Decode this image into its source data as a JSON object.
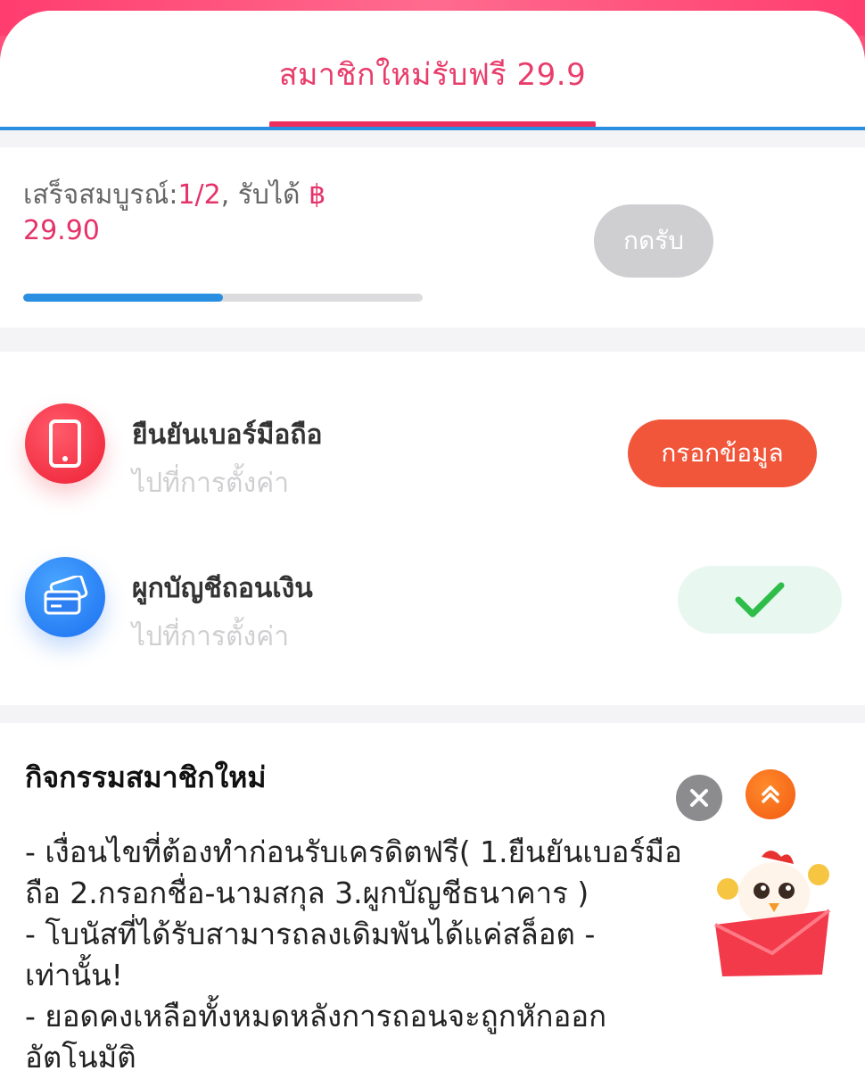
{
  "header": {
    "tab_label": "สมาชิกใหม่รับฟรี 29.9"
  },
  "progress": {
    "prefix": "เสร็จสมบูรณ์:",
    "completed": "1/2",
    "middle": ", รับได้ ",
    "currency": "฿",
    "amount": "29.90",
    "claim_button": "กดรับ",
    "fraction": 0.5
  },
  "tasks": [
    {
      "icon": "phone-icon",
      "title": "ยืนยันเบอร์มือถือ",
      "subtitle": "ไปที่การตั้งค่า",
      "button": "กรอกข้อมูล",
      "status": "pending"
    },
    {
      "icon": "bank-card-icon",
      "title": "ผูกบัญชีถอนเงิน",
      "subtitle": "ไปที่การตั้งค่า",
      "status": "done",
      "status_icon": "check-icon"
    }
  ],
  "rules": {
    "title": "กิจกรรมสมาชิกใหม่",
    "body": "- เงื่อนไขที่ต้องทำก่อนรับเครดิตฟรี( 1.ยืนยันเบอร์มือ\nถือ  2.กรอกชื่อ-นามสกุล  3.ผูกบัญชีธนาคาร )\n- โบนัสที่ได้รับสามารถลงเดิมพันได้แค่สล็อต - \nเท่านั้น!\n- ยอดคงเหลือทั้งหมดหลังการถอนจะถูกหักออก\nอัตโนมัติ"
  },
  "floating": {
    "close_icon": "close-icon",
    "up_icon": "double-chevron-up-icon",
    "mascot_icon": "rooster-red-envelope-icon"
  },
  "colors": {
    "accent_pink": "#e4336a",
    "accent_blue": "#2a8fe0",
    "cta_orange": "#f2563a",
    "success_green": "#2fbd4a"
  }
}
